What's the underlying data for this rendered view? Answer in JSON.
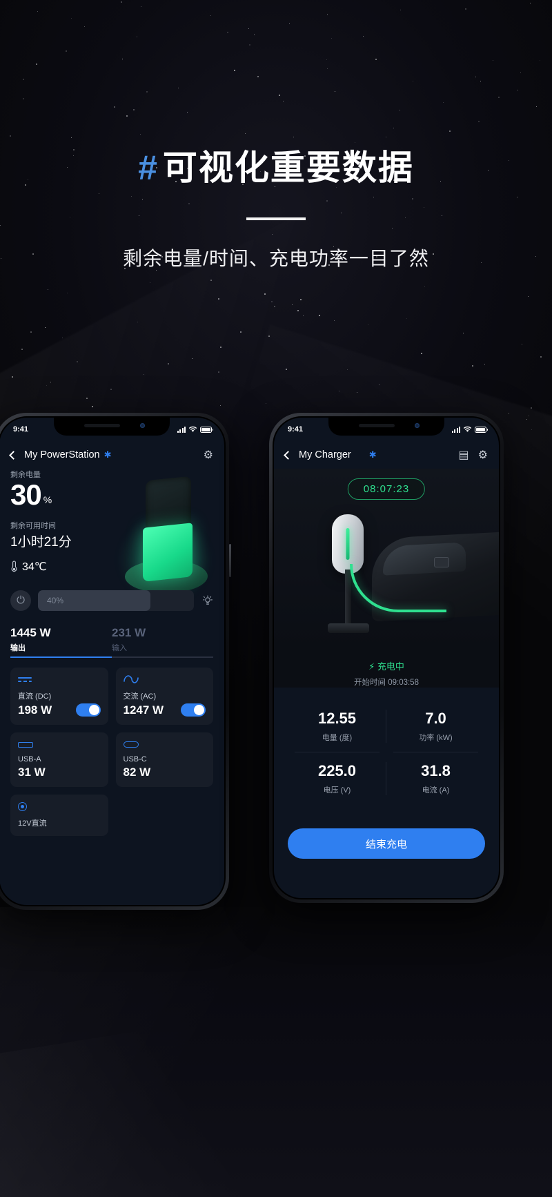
{
  "hero": {
    "hash": "#",
    "headline": "可视化重要数据",
    "subhead": "剩余电量/时间、充电功率一目了然"
  },
  "colors": {
    "accent_blue": "#2f7ff0",
    "accent_green": "#2fe08f",
    "hash_blue": "#4a8fe0",
    "bg": "#0a0a10",
    "card": "#171d28"
  },
  "left_phone": {
    "status_bar": {
      "time": "9:41"
    },
    "nav": {
      "back_icon": "chevron-left-icon",
      "title": "My PowerStation",
      "bluetooth_icon": "✱",
      "settings_icon": "⚙"
    },
    "battery": {
      "remaining_label": "剩余电量",
      "percent": "30",
      "percent_sign": "%",
      "time_label": "剩余可用时间",
      "time_value": "1小时21分",
      "temp_icon": "🌡",
      "temp_value": "34℃"
    },
    "slider": {
      "power_icon": "⏻",
      "value": "40%",
      "bulb_icon": "☀"
    },
    "io": {
      "output_value": "1445 W",
      "output_label": "输出",
      "input_value": "231 W",
      "input_label": "输入"
    },
    "cards": [
      {
        "icon": "dc-line-icon",
        "name": "直流 (DC)",
        "value": "198 W",
        "toggle": true
      },
      {
        "icon": "ac-wave-icon",
        "name": "交流 (AC)",
        "value": "1247 W",
        "toggle": true
      },
      {
        "icon": "usb-a-icon",
        "name": "USB-A",
        "value": "31 W",
        "toggle": false
      },
      {
        "icon": "usb-c-icon",
        "name": "USB-C",
        "value": "82 W",
        "toggle": false
      },
      {
        "icon": "dc-round-icon",
        "name": "12V直流",
        "value": "",
        "toggle": false
      }
    ]
  },
  "right_phone": {
    "status_bar": {
      "time": "9:41"
    },
    "nav": {
      "back_icon": "chevron-left-icon",
      "title": "My Charger",
      "bluetooth_icon": "✱",
      "record_icon": "▤",
      "settings_icon": "⚙"
    },
    "timer": "08:07:23",
    "status": {
      "bolt_icon": "⚡",
      "text": "充电中",
      "start_time": "开始时间 09:03:58"
    },
    "stats": [
      {
        "value": "12.55",
        "label": "电量 (度)"
      },
      {
        "value": "7.0",
        "label": "功率 (kW)"
      },
      {
        "value": "225.0",
        "label": "电压 (V)"
      },
      {
        "value": "31.8",
        "label": "电流 (A)"
      }
    ],
    "end_button": "结束充电"
  }
}
